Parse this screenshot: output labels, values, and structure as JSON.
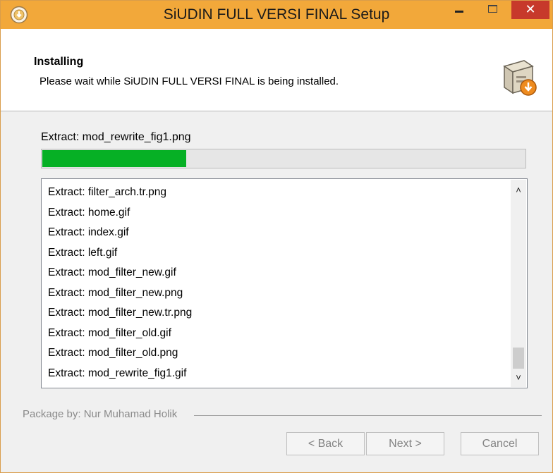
{
  "window": {
    "title": "SiUDIN FULL VERSI FINAL Setup",
    "accent_color": "#f2a83a",
    "close_symbol": "✕",
    "icons": [
      "installer-app-icon",
      "minimize-icon",
      "maximize-icon",
      "close-icon"
    ]
  },
  "header": {
    "title": "Installing",
    "subtitle": "Please wait while SiUDIN FULL VERSI FINAL is being installed.",
    "icon": "installer-box-icon"
  },
  "progress": {
    "current_file": "Extract: mod_rewrite_fig1.png",
    "percent": 30,
    "fill_color": "#06b025"
  },
  "details_log": {
    "items": [
      "Extract: filter_arch.tr.png",
      "Extract: home.gif",
      "Extract: index.gif",
      "Extract: left.gif",
      "Extract: mod_filter_new.gif",
      "Extract: mod_filter_new.png",
      "Extract: mod_filter_new.tr.png",
      "Extract: mod_filter_old.gif",
      "Extract: mod_filter_old.png",
      "Extract: mod_rewrite_fig1.gif"
    ],
    "scroll_up_symbol": "˄",
    "scroll_down_symbol": "˅"
  },
  "branding": {
    "text": "Package by: Nur Muhamad Holik"
  },
  "buttons": {
    "back": "< Back",
    "next": "Next >",
    "cancel": "Cancel"
  }
}
